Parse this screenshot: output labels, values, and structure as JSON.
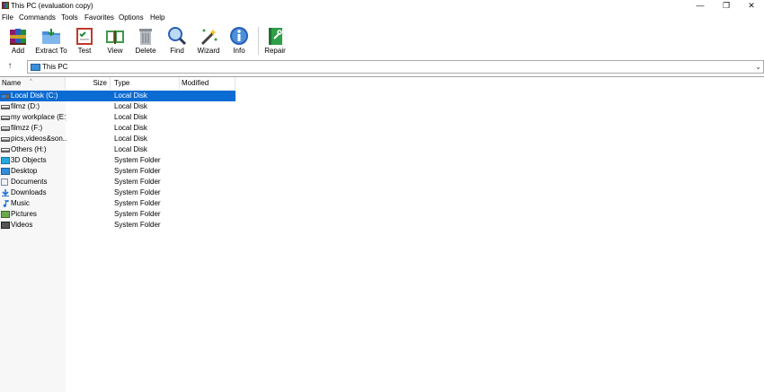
{
  "window": {
    "title": "This PC (evaluation copy)",
    "controls": {
      "minimize": "—",
      "restore": "❐",
      "close": "✕"
    }
  },
  "menu": [
    "File",
    "Commands",
    "Tools",
    "Favorites",
    "Options",
    "Help"
  ],
  "toolbar": [
    {
      "name": "add",
      "label": "Add",
      "icon": "archive-books-icon"
    },
    {
      "name": "extract-to",
      "label": "Extract To",
      "icon": "folder-extract-icon"
    },
    {
      "name": "test",
      "label": "Test",
      "icon": "checklist-icon"
    },
    {
      "name": "view",
      "label": "View",
      "icon": "open-book-icon"
    },
    {
      "name": "delete",
      "label": "Delete",
      "icon": "trash-can-icon"
    },
    {
      "name": "find",
      "label": "Find",
      "icon": "magnifier-icon"
    },
    {
      "name": "wizard",
      "label": "Wizard",
      "icon": "magic-wand-icon"
    },
    {
      "name": "info",
      "label": "Info",
      "icon": "info-icon"
    },
    {
      "name": "repair",
      "label": "Repair",
      "icon": "repair-book-icon"
    }
  ],
  "address": {
    "up": "↑",
    "path": "This PC",
    "dropdown": "⌄"
  },
  "columns": {
    "name": "Name",
    "size": "Size",
    "type": "Type",
    "modified": "Modified",
    "sort": "^"
  },
  "files": [
    {
      "name": "Local Disk (C:)",
      "type": "Local Disk",
      "icon": "windows-drive-icon",
      "selected": true
    },
    {
      "name": "filmz (D:)",
      "type": "Local Disk",
      "icon": "drive-icon"
    },
    {
      "name": "my workplace (E:)",
      "type": "Local Disk",
      "icon": "drive-icon"
    },
    {
      "name": "filmzz (F:)",
      "type": "Local Disk",
      "icon": "drive-icon"
    },
    {
      "name": "pics,videos&son...",
      "type": "Local Disk",
      "icon": "drive-icon"
    },
    {
      "name": "Others (H:)",
      "type": "Local Disk",
      "icon": "drive-icon"
    },
    {
      "name": "3D Objects",
      "type": "System Folder",
      "icon": "3d-objects-icon"
    },
    {
      "name": "Desktop",
      "type": "System Folder",
      "icon": "desktop-icon"
    },
    {
      "name": "Documents",
      "type": "System Folder",
      "icon": "documents-icon"
    },
    {
      "name": "Downloads",
      "type": "System Folder",
      "icon": "downloads-icon"
    },
    {
      "name": "Music",
      "type": "System Folder",
      "icon": "music-icon"
    },
    {
      "name": "Pictures",
      "type": "System Folder",
      "icon": "pictures-icon"
    },
    {
      "name": "Videos",
      "type": "System Folder",
      "icon": "videos-icon"
    }
  ],
  "colors": {
    "selection": "#0a6bd3",
    "background": "#ffffff"
  }
}
